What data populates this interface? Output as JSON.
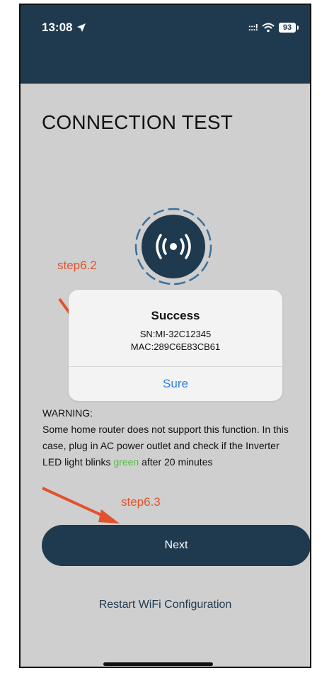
{
  "status_bar": {
    "time": "13:08",
    "signal_text": ":::!",
    "battery": "93"
  },
  "page": {
    "title": "CONNECTION TEST"
  },
  "annotations": {
    "step_62": "step6.2",
    "step_63": "step6.3",
    "color": "#e2522e"
  },
  "dialog": {
    "title": "Success",
    "sn": "SN:MI-32C12345",
    "mac": "MAC:289C6E83CB61",
    "button": "Sure"
  },
  "warning": {
    "heading": "WARNING:",
    "text_before": "Some home router does not support this function. In this case, plug in AC power outlet and check if the Inverter LED light blinks ",
    "green_word": "green",
    "text_after": " after 20 minutes"
  },
  "buttons": {
    "next": "Next",
    "restart": "Restart WiFi Configuration"
  },
  "colors": {
    "header": "#1f3a4f",
    "background": "#cfcfcf",
    "link_blue": "#2f80d8",
    "green": "#4cc23a"
  }
}
